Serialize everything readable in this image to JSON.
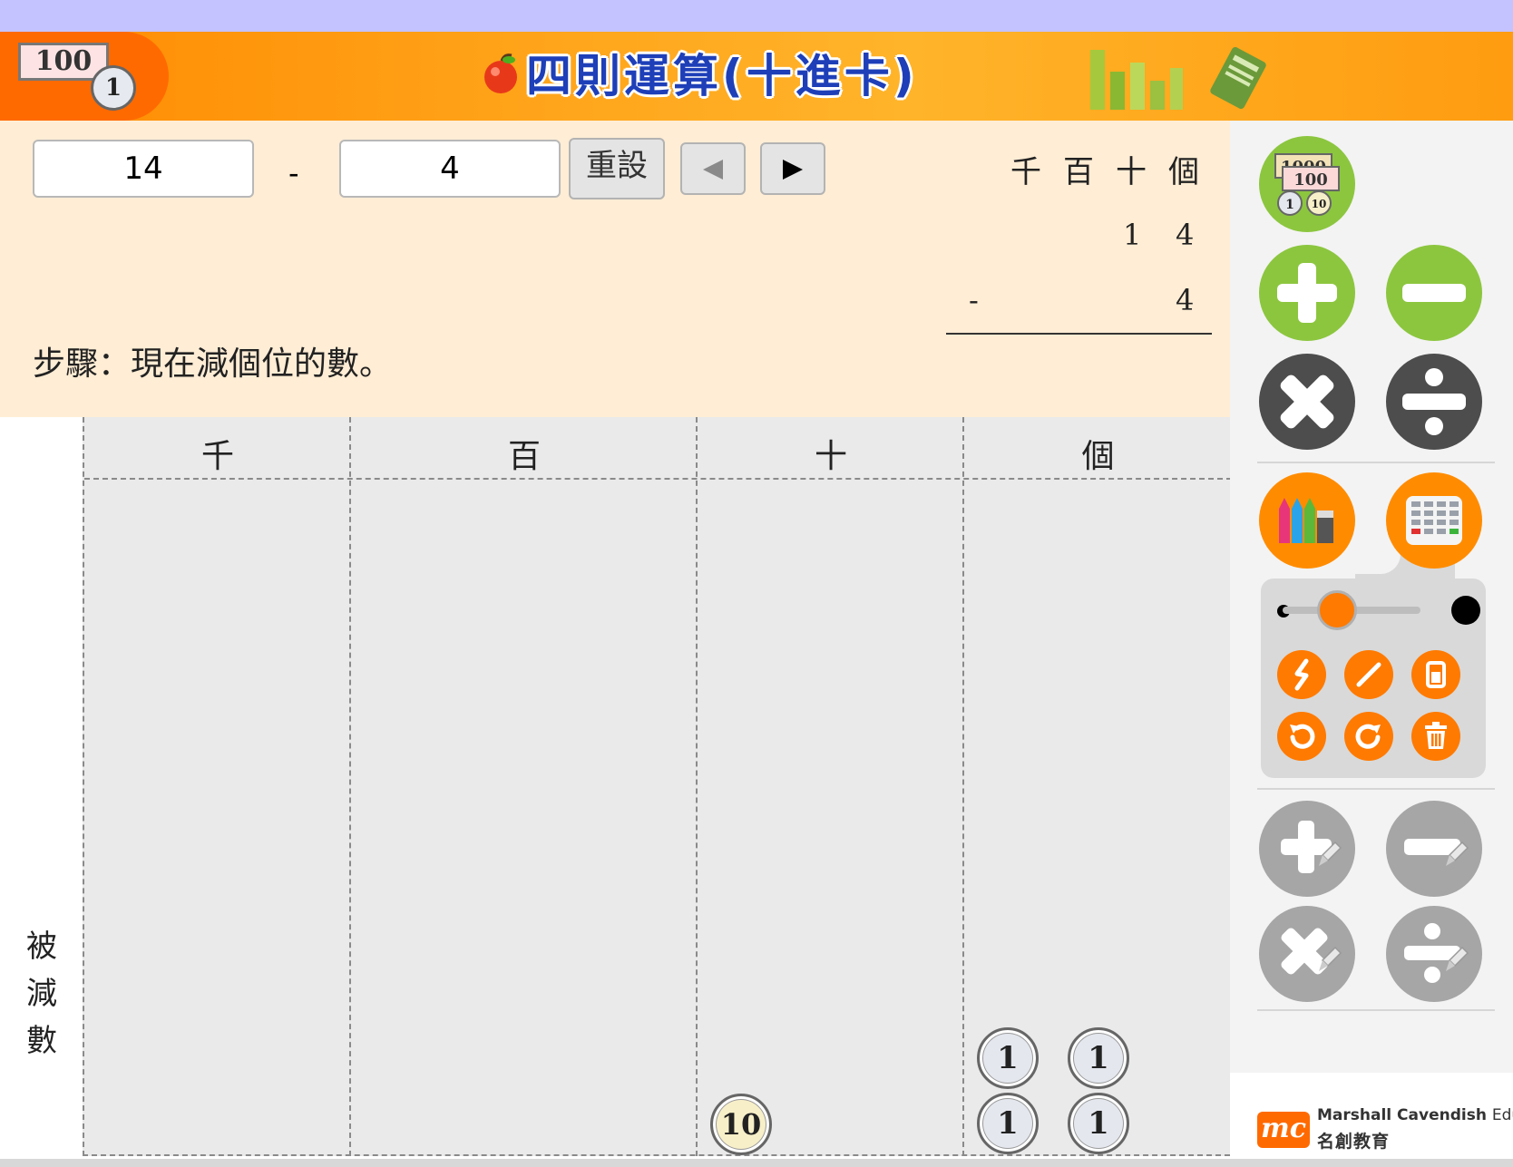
{
  "header": {
    "title": "四則運算(十進卡)",
    "badge_note": "100",
    "badge_coin": "1"
  },
  "question": {
    "minuend": "14",
    "operator": "-",
    "subtrahend": "4",
    "reset_label": "重設",
    "place_headers": [
      "千",
      "百",
      "十",
      "個"
    ],
    "vertical": {
      "row1": [
        "1",
        "4"
      ],
      "row2_op": "-",
      "row2": [
        "4"
      ]
    },
    "step_text": "步驟：現在減個位的數。"
  },
  "board": {
    "columns": [
      "千",
      "百",
      "十",
      "個"
    ],
    "row_label": [
      "被",
      "減",
      "數"
    ],
    "tens_cards": [
      "10"
    ],
    "ones_cards": [
      "1",
      "1",
      "1",
      "1"
    ]
  },
  "toolbar": {
    "money_icon_labels": [
      "1000",
      "100",
      "1",
      "10"
    ],
    "colors": {
      "green": "#8cc63f",
      "dark": "#4d4d4d",
      "orange": "#ff8c00",
      "grey": "#a6a6a6"
    }
  },
  "logo": {
    "mark": "mc",
    "name_bold": "Marshall Cavendish",
    "name_thin": "Education",
    "name_zh": "名創教育"
  }
}
